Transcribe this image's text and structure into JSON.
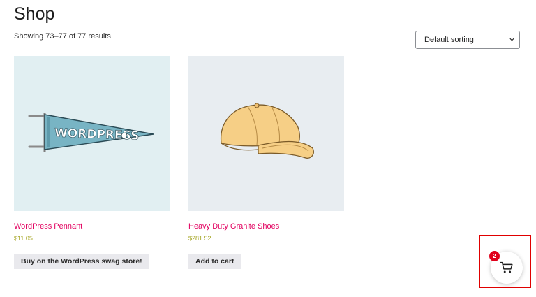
{
  "page": {
    "title": "Shop",
    "result_count": "Showing 73–77 of 77 results"
  },
  "sorting": {
    "selected": "Default sorting"
  },
  "products": [
    {
      "name": "WordPress Pennant",
      "price": "$11.05",
      "button_label": "Buy on the WordPress swag store!",
      "image": "wordpress-pennant-image",
      "pennant_text": "WORDPRESS",
      "background": "#e1eff2"
    },
    {
      "name": "Heavy Duty Granite Shoes",
      "price": "$281.52",
      "button_label": "Add to cart",
      "image": "yellow-cap-image",
      "background": "#e8edf1"
    }
  ],
  "cart": {
    "count": "2",
    "icon": "cart-icon"
  },
  "colors": {
    "product_link": "#e2005f",
    "price": "#a3a31e",
    "button_bg": "#e9e9ed",
    "badge": "#e0001b",
    "highlight": "#e00000"
  }
}
